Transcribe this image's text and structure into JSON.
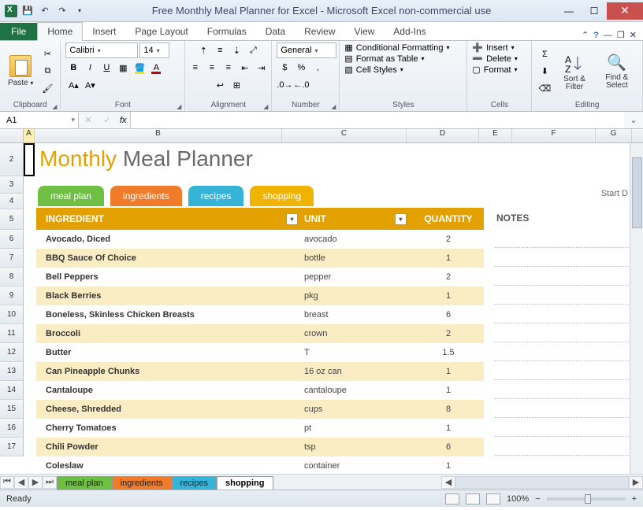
{
  "window": {
    "title": "Free Monthly Meal Planner for Excel  -  Microsoft Excel non-commercial use"
  },
  "ribbon": {
    "file": "File",
    "tabs": [
      "Home",
      "Insert",
      "Page Layout",
      "Formulas",
      "Data",
      "Review",
      "View",
      "Add-Ins"
    ],
    "active": "Home",
    "groups": {
      "clipboard": "Clipboard",
      "font": "Font",
      "alignment": "Alignment",
      "number": "Number",
      "styles": "Styles",
      "cells": "Cells",
      "editing": "Editing"
    },
    "paste": "Paste",
    "font_name": "Calibri",
    "font_size": "14",
    "number_format": "General",
    "cond_fmt": "Conditional Formatting",
    "fmt_table": "Format as Table",
    "cell_styles": "Cell Styles",
    "insert": "Insert",
    "delete": "Delete",
    "format": "Format",
    "sort_filter": "Sort & Filter",
    "find_select": "Find & Select"
  },
  "namebox": "A1",
  "fx": "fx",
  "columns": [
    "A",
    "B",
    "C",
    "D",
    "E",
    "F",
    "G"
  ],
  "row_numbers": [
    "2",
    "3",
    "4",
    "5",
    "6",
    "7",
    "8",
    "9",
    "10",
    "11",
    "12",
    "13",
    "14",
    "15",
    "16",
    "17"
  ],
  "planner": {
    "title_a": "Monthly",
    "title_b": " Meal Planner",
    "tabs": {
      "meal": "meal plan",
      "ing": "ingredients",
      "rec": "recipes",
      "shop": "shopping"
    },
    "headers": {
      "ingredient": "INGREDIENT",
      "unit": "UNIT",
      "qty": "QUANTITY"
    },
    "notes": "NOTES",
    "startd": "Start D",
    "rows": [
      {
        "ing": "Avocado, Diced",
        "unit": "avocado",
        "qty": "2"
      },
      {
        "ing": "BBQ Sauce Of Choice",
        "unit": "bottle",
        "qty": "1"
      },
      {
        "ing": "Bell Peppers",
        "unit": "pepper",
        "qty": "2"
      },
      {
        "ing": "Black Berries",
        "unit": "pkg",
        "qty": "1"
      },
      {
        "ing": "Boneless, Skinless Chicken Breasts",
        "unit": "breast",
        "qty": "6"
      },
      {
        "ing": "Broccoli",
        "unit": "crown",
        "qty": "2"
      },
      {
        "ing": "Butter",
        "unit": "T",
        "qty": "1.5"
      },
      {
        "ing": "Can Pineapple Chunks",
        "unit": "16 oz can",
        "qty": "1"
      },
      {
        "ing": "Cantaloupe",
        "unit": "cantaloupe",
        "qty": "1"
      },
      {
        "ing": "Cheese, Shredded",
        "unit": "cups",
        "qty": "8"
      },
      {
        "ing": "Cherry Tomatoes",
        "unit": "pt",
        "qty": "1"
      },
      {
        "ing": "Chili Powder",
        "unit": "tsp",
        "qty": "6"
      },
      {
        "ing": "Coleslaw",
        "unit": "container",
        "qty": "1"
      }
    ]
  },
  "sheets": {
    "meal": "meal plan",
    "ing": "ingredients",
    "rec": "recipes",
    "shop": "shopping"
  },
  "status": {
    "ready": "Ready",
    "zoom": "100%"
  }
}
